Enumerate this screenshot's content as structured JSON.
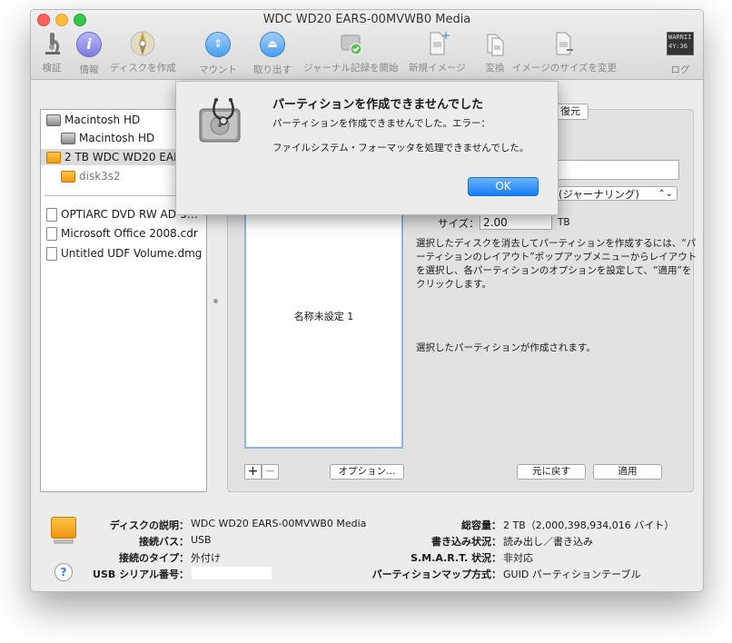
{
  "window": {
    "title": "WDC WD20 EARS-00MVWB0 Media"
  },
  "toolbar": {
    "items": [
      {
        "label": "検証",
        "icon": "microscope-icon"
      },
      {
        "label": "情報",
        "icon": "info-icon"
      },
      {
        "label": "ディスクを作成",
        "icon": "burn-disc-icon"
      },
      {
        "label": "マウント",
        "icon": "mount-icon"
      },
      {
        "label": "取り出す",
        "icon": "eject-icon"
      },
      {
        "label": "ジャーナル記録を開始",
        "icon": "journal-icon"
      },
      {
        "label": "新規イメージ",
        "icon": "new-image-icon"
      },
      {
        "label": "変換",
        "icon": "convert-icon"
      },
      {
        "label": "イメージのサイズを変更",
        "icon": "resize-image-icon"
      },
      {
        "label": "ログ",
        "icon": "log-icon",
        "badge_line1": "WARNII",
        "badge_line2": "4Y:36"
      }
    ]
  },
  "sidebar": {
    "items": [
      {
        "label": "Macintosh HD"
      },
      {
        "label": "Macintosh HD"
      },
      {
        "label": "2 TB WDC WD20 EARS-00MVWB0 Media"
      },
      {
        "label": "disk3s2"
      },
      {
        "label": "OPTIARC DVD RW AD-5…"
      },
      {
        "label": "Microsoft Office 2008.cdr"
      },
      {
        "label": "Untitled UDF Volume.dmg"
      }
    ]
  },
  "partition": {
    "restore_tab": "復元",
    "format_value": "(ジャーナリング)",
    "size_label": "サイズ：",
    "size_value": "2.00",
    "size_unit": "TB",
    "description": "選択したディスクを消去してパーティションを作成するには、“パーティションのレイアウト”ポップアップメニューからレイアウトを選択し、各パーティションのオプションを設定して、“適用”をクリックします。",
    "status": "選択したパーティションが作成されます。",
    "partition_name": "名称未設定 1",
    "add_label": "+",
    "remove_label": "−",
    "options_button": "オプション…",
    "revert_button": "元に戻す",
    "apply_button": "適用"
  },
  "info": {
    "description_key": "ディスクの説明：",
    "description_val": "WDC WD20 EARS-00MVWB0 Media",
    "bus_key": "接続バス：",
    "bus_val": "USB",
    "type_key": "接続のタイプ：",
    "type_val": "外付け",
    "serial_key": "USB シリアル番号：",
    "capacity_key": "総容量：",
    "capacity_val": "2 TB（2,000,398,934,016 バイト）",
    "write_key": "書き込み状況：",
    "write_val": "読み出し／書き込み",
    "smart_key": "S.M.A.R.T. 状況：",
    "smart_val": "非対応",
    "map_key": "パーティションマップ方式：",
    "map_val": "GUID パーティションテーブル",
    "help_label": "?"
  },
  "alert": {
    "title": "パーティションを作成できませんでした",
    "message1": "パーティションを作成できませんでした。エラー：",
    "message2": "ファイルシステム・フォーマッタを処理できませんでした。",
    "ok_label": "OK"
  }
}
